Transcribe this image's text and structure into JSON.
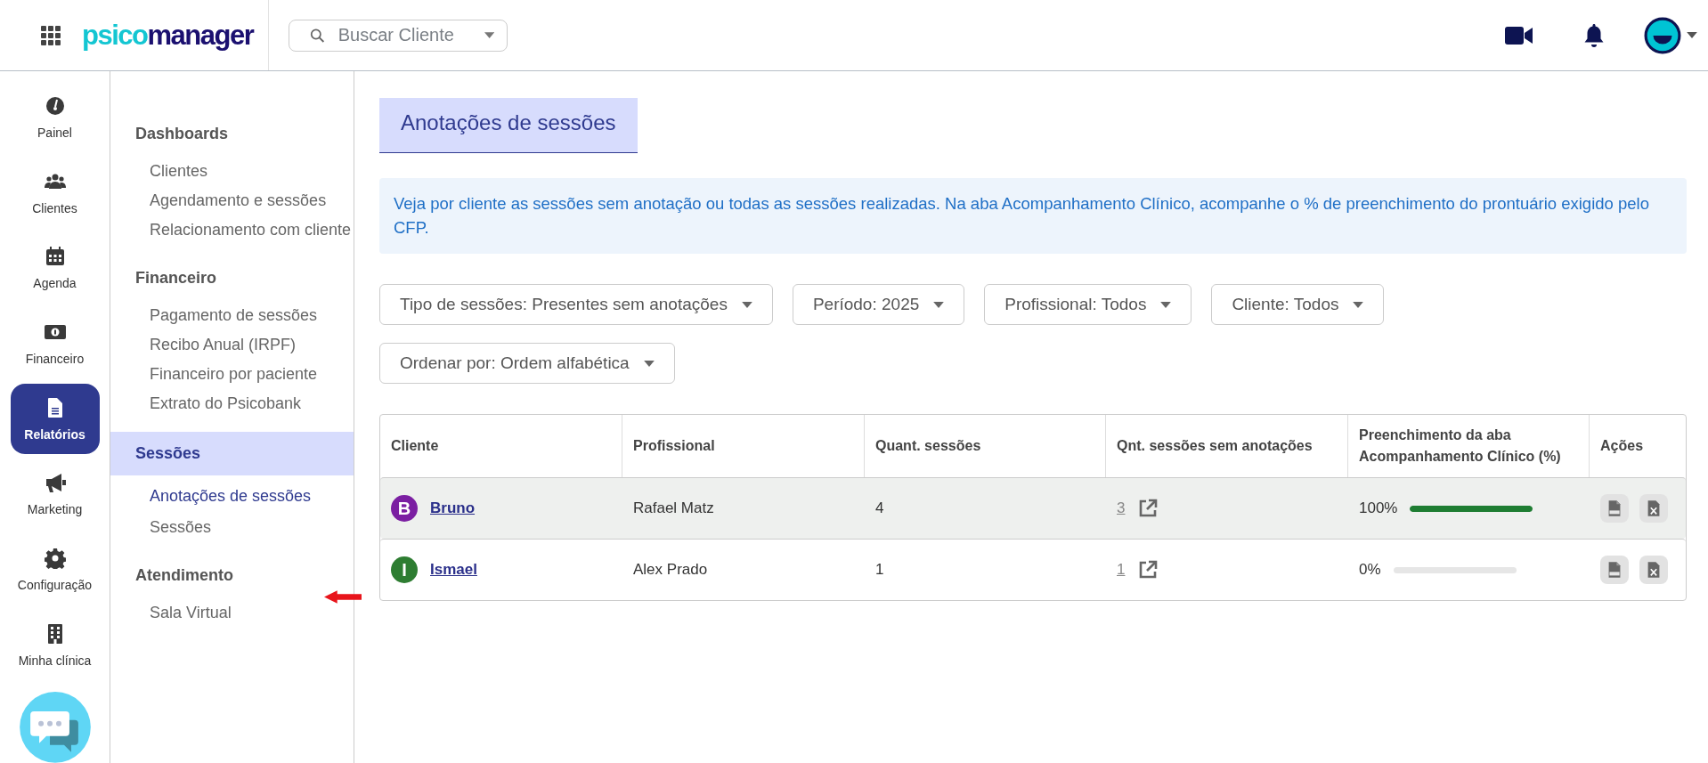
{
  "topbar": {
    "logo": {
      "first": "psico",
      "second": "manager"
    },
    "search": {
      "placeholder": "Buscar Cliente"
    }
  },
  "rail": [
    {
      "label": "Painel",
      "selected": false
    },
    {
      "label": "Clientes",
      "selected": false
    },
    {
      "label": "Agenda",
      "selected": false
    },
    {
      "label": "Financeiro",
      "selected": false
    },
    {
      "label": "Relatórios",
      "selected": true
    },
    {
      "label": "Marketing",
      "selected": false
    },
    {
      "label": "Configuração",
      "selected": false
    },
    {
      "label": "Minha clínica",
      "selected": false
    }
  ],
  "submenu": [
    {
      "title": "Dashboards",
      "selected": false,
      "items": [
        {
          "label": "Clientes",
          "selected": false
        },
        {
          "label": "Agendamento e sessões",
          "selected": false
        },
        {
          "label": "Relacionamento com cliente",
          "selected": false
        }
      ]
    },
    {
      "title": "Financeiro",
      "selected": false,
      "items": [
        {
          "label": "Pagamento de sessões",
          "selected": false
        },
        {
          "label": "Recibo Anual (IRPF)",
          "selected": false
        },
        {
          "label": "Financeiro por paciente",
          "selected": false
        },
        {
          "label": "Extrato do Psicobank",
          "selected": false
        }
      ]
    },
    {
      "title": "Sessões",
      "selected": true,
      "items": [
        {
          "label": "Anotações de sessões",
          "selected": true
        },
        {
          "label": "Sessões",
          "selected": false
        }
      ]
    },
    {
      "title": "Atendimento",
      "selected": false,
      "items": [
        {
          "label": "Sala Virtual",
          "selected": false
        }
      ]
    }
  ],
  "page": {
    "title": "Anotações de sessões",
    "info": "Veja por cliente as sessões sem anotação ou todas as sessões realizadas. Na aba Acompanhamento Clínico, acompanhe o % de preenchimento do prontuário exigido pelo CFP.",
    "filters": [
      "Tipo de sessões: Presentes sem anotações",
      "Período: 2025",
      "Profissional: Todos",
      "Cliente: Todos",
      "Ordenar por: Ordem alfabética"
    ]
  },
  "table": {
    "columns": [
      "Cliente",
      "Profissional",
      "Quant. sessões",
      "Qnt. sessões sem anotações",
      "Preenchimento da aba Acompanhamento Clínico (%)",
      "Ações"
    ],
    "rows": [
      {
        "initial": "B",
        "color": "#7b1fa2",
        "name": "Bruno",
        "professional": "Rafael Matz",
        "sessions": "4",
        "unannotated": "3",
        "fill": "100%",
        "level": 1,
        "selected": true
      },
      {
        "initial": "I",
        "color": "#2e7d32",
        "name": "Ismael",
        "professional": "Alex Prado",
        "sessions": "1",
        "unannotated": "1",
        "fill": "0%",
        "level": 0,
        "selected": false
      }
    ]
  }
}
